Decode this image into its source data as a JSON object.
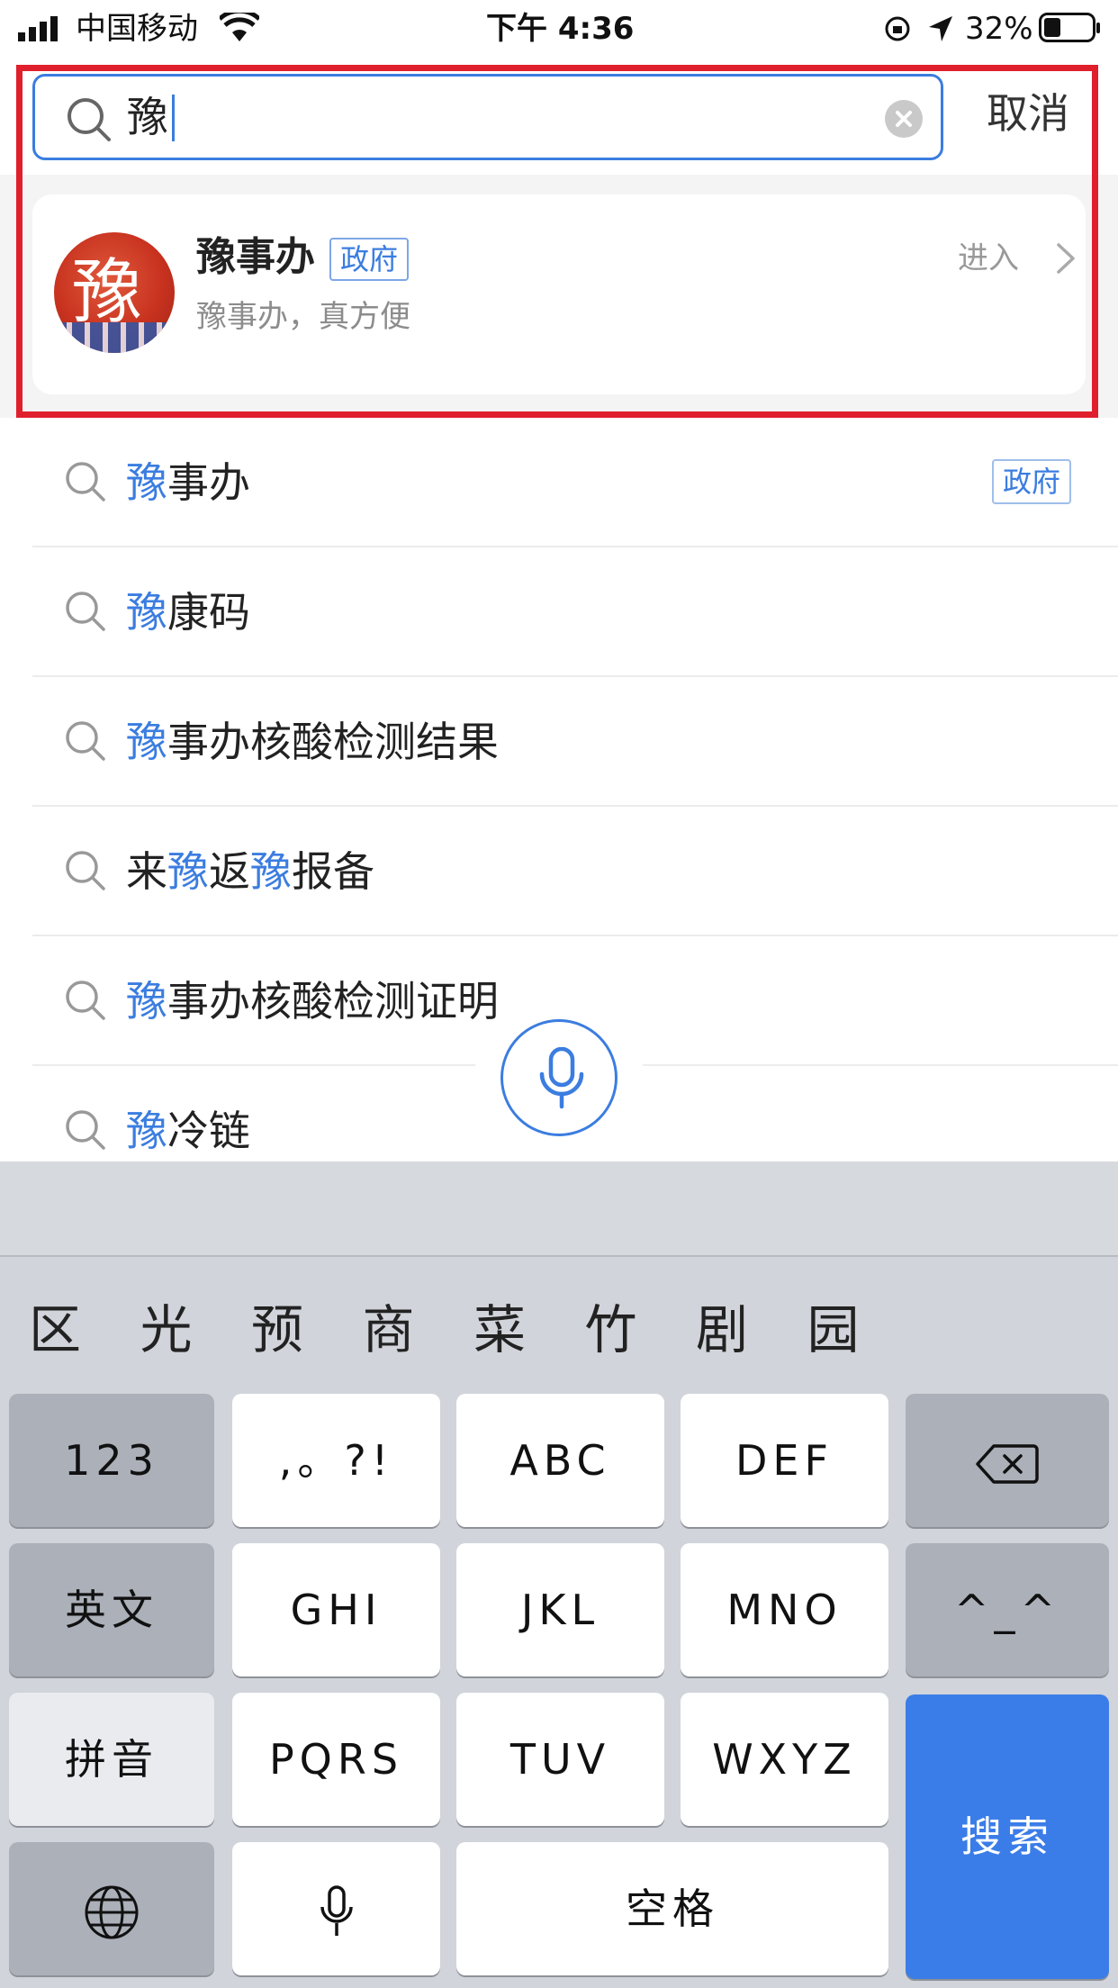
{
  "status_bar": {
    "carrier": "中国移动",
    "time": "下午 4:36",
    "battery": "32%"
  },
  "search": {
    "query": "豫",
    "cancel_label": "取消"
  },
  "app_result": {
    "name": "豫事办",
    "tag": "政府",
    "description": "豫事办，真方便",
    "enter_label": "进入",
    "avatar_glyph": "豫"
  },
  "suggestions": [
    {
      "parts": [
        {
          "t": "豫",
          "hl": true
        },
        {
          "t": "事办",
          "hl": false
        }
      ],
      "tag": "政府"
    },
    {
      "parts": [
        {
          "t": "豫",
          "hl": true
        },
        {
          "t": "康码",
          "hl": false
        }
      ],
      "tag": ""
    },
    {
      "parts": [
        {
          "t": "豫",
          "hl": true
        },
        {
          "t": "事办核酸检测结果",
          "hl": false
        }
      ],
      "tag": ""
    },
    {
      "parts": [
        {
          "t": "来",
          "hl": false
        },
        {
          "t": "豫",
          "hl": true
        },
        {
          "t": "返",
          "hl": false
        },
        {
          "t": "豫",
          "hl": true
        },
        {
          "t": "报备",
          "hl": false
        }
      ],
      "tag": ""
    },
    {
      "parts": [
        {
          "t": "豫",
          "hl": true
        },
        {
          "t": "事办核酸检测证明",
          "hl": false
        }
      ],
      "tag": ""
    },
    {
      "parts": [
        {
          "t": "豫",
          "hl": true
        },
        {
          "t": "冷链",
          "hl": false
        }
      ],
      "tag": ""
    }
  ],
  "keyboard": {
    "candidates": [
      "区",
      "光",
      "预",
      "商",
      "菜",
      "竹",
      "剧",
      "园"
    ],
    "rows": [
      [
        {
          "label": "123",
          "style": "gray"
        },
        {
          "label": ",。?!",
          "style": "white"
        },
        {
          "label": "ABC",
          "style": "white"
        },
        {
          "label": "DEF",
          "style": "white"
        },
        {
          "label": "",
          "icon": "backspace-icon",
          "style": "gray"
        }
      ],
      [
        {
          "label": "英文",
          "style": "gray"
        },
        {
          "label": "GHI",
          "style": "white"
        },
        {
          "label": "JKL",
          "style": "white"
        },
        {
          "label": "MNO",
          "style": "white"
        },
        {
          "label": "^_^",
          "style": "gray"
        }
      ],
      [
        {
          "label": "拼音",
          "style": "light"
        },
        {
          "label": "PQRS",
          "style": "white"
        },
        {
          "label": "TUV",
          "style": "white"
        },
        {
          "label": "WXYZ",
          "style": "white"
        }
      ],
      [
        {
          "label": "",
          "icon": "globe-icon",
          "style": "gray"
        },
        {
          "label": "",
          "icon": "microphone-icon",
          "style": "white"
        },
        {
          "label": "空格",
          "style": "white"
        }
      ]
    ],
    "search_key_label": "搜索"
  },
  "colors": {
    "accent": "#3b7de0",
    "highlight_border": "#e01f2d",
    "search_key": "#3b7de8"
  }
}
